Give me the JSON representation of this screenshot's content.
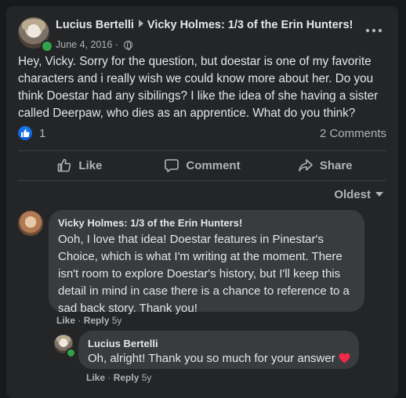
{
  "post": {
    "author": "Lucius Bertelli",
    "target": "Vicky Holmes: 1/3 of the Erin Hunters!",
    "date": "June 4, 2016",
    "separator": "·",
    "more_icon": "more-horizontal-icon",
    "text": "Hey, Vicky. Sorry for the question, but doestar is one of my favorite characters and i really wish we could know more about her. Do you think Doestar had any sibilings? I like the idea of she having a sister called Deerpaw, who dies as an apprentice. What do you think?",
    "like_count": "1",
    "comments_count": "2 Comments"
  },
  "actions": {
    "like": "Like",
    "comment": "Comment",
    "share": "Share"
  },
  "sort": {
    "label": "Oldest"
  },
  "comments": [
    {
      "author": "Vicky Holmes: 1/3 of the Erin Hunters!",
      "text": "Ooh, I love that idea! Doestar features in Pinestar's Choice, which is what I'm writing at the moment. There isn't room to explore Doestar's history, but I'll keep this detail in mind in case there is a chance to reference to a sad back story. Thank you!",
      "like": "Like",
      "dot": "·",
      "reply": "Reply",
      "time": "5y"
    },
    {
      "author": "Lucius Bertelli",
      "text": "Oh, alright! Thank you so much for your answer",
      "like": "Like",
      "dot": "·",
      "reply": "Reply",
      "time": "5y"
    }
  ],
  "colors": {
    "background": "#18191a",
    "card": "#242526",
    "bubble": "#3a3b3c",
    "text": "#e4e6eb",
    "secondary": "#b0b3b8",
    "like_blue": "#1877f2",
    "online": "#31a24c",
    "heart": "#f02849"
  }
}
